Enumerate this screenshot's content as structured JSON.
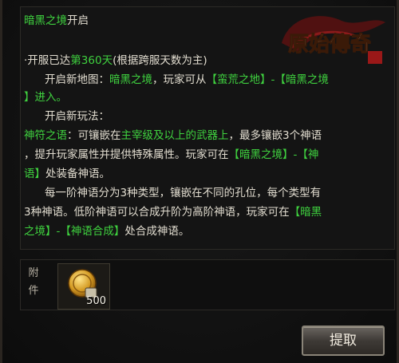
{
  "mail": {
    "l1": {
      "a": "暗黑之境",
      "b": "开启"
    },
    "l2": {
      "a": "·开服已达",
      "b": "第360天",
      "c": "(根据跨服天数为主)"
    },
    "l3": {
      "a": "开启新地图：",
      "b": "暗黑之境",
      "c": "，玩家可从",
      "d": "【蛮荒之地】-【暗黑之境",
      "e": "】进入。"
    },
    "l4": {
      "a": "开启新玩法："
    },
    "l5": {
      "a": "神符之语",
      "b": "：可镶嵌在",
      "c": "主宰级及以上的武器上",
      "d": "，最多镶嵌3个神语"
    },
    "l6": {
      "a": "，提升玩家属性并提供特殊属性。玩家可在",
      "b": "【暗黑之境】-【神"
    },
    "l7": {
      "a": "语】",
      "b": "处装备神语。"
    },
    "l8": {
      "a": "每一阶神语分为3种类型，镶嵌在不同的孔位，每个类型有"
    },
    "l9": {
      "a": "3种神语。低阶神语可以合成升阶为高阶神语，玩家可在",
      "b": "【暗黑"
    },
    "l10": {
      "a": "之境】-【神语合成】",
      "b": "处合成神语。"
    }
  },
  "logo": {
    "text": "原始傳奇",
    "icon": "dragon-logo-icon"
  },
  "attachment": {
    "label": "附件",
    "item_icon": "gold-coin-icon",
    "item_count": "500"
  },
  "button": {
    "claim_label": "提取"
  },
  "colors": {
    "accent_green": "#3fd23f",
    "text": "#e2ddd0"
  }
}
